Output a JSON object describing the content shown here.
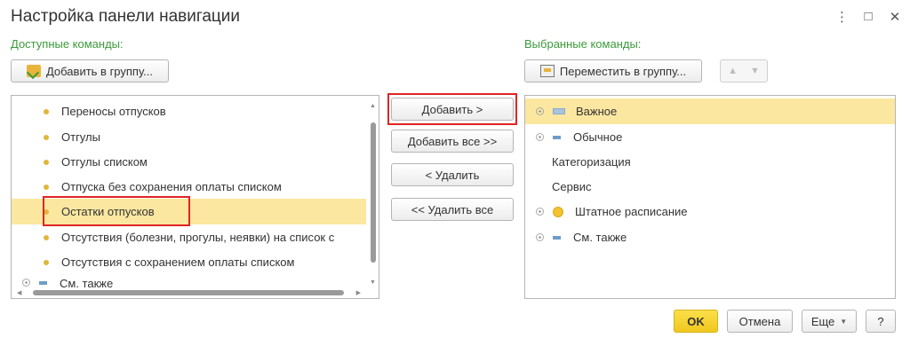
{
  "window": {
    "title": "Настройка панели навигации",
    "controls": [
      "⋮",
      "□",
      "✕"
    ]
  },
  "left": {
    "label": "Доступные команды:",
    "add_group_label": "Добавить в группу...",
    "items": [
      {
        "label": "Переносы отпусков",
        "selected": false
      },
      {
        "label": "Отгулы",
        "selected": false
      },
      {
        "label": "Отгулы списком",
        "selected": false
      },
      {
        "label": "Отпуска без сохранения оплаты списком",
        "selected": false
      },
      {
        "label": "Остатки отпусков",
        "selected": true
      },
      {
        "label": "Отсутствия (болезни, прогулы, неявки) на список с",
        "selected": false
      },
      {
        "label": "Отсутствия с сохранением оплаты списком",
        "selected": false
      }
    ],
    "partial_item": "См. также"
  },
  "middle": {
    "add": "Добавить >",
    "add_all": "Добавить все >>",
    "remove": "< Удалить",
    "remove_all": "<< Удалить все"
  },
  "right": {
    "label": "Выбранные команды:",
    "move_group_label": "Переместить в группу...",
    "items": [
      {
        "label": "Важное",
        "icon": "group-rect-icon",
        "expandable": true,
        "selected": true
      },
      {
        "label": "Обычное",
        "icon": "group-dash-icon",
        "expandable": true,
        "selected": false
      },
      {
        "label": "Категоризация",
        "icon": "",
        "expandable": false,
        "selected": false
      },
      {
        "label": "Сервис",
        "icon": "",
        "expandable": false,
        "selected": false
      },
      {
        "label": "Штатное расписание",
        "icon": "group-circle-icon",
        "expandable": true,
        "selected": false
      },
      {
        "label": "См. также",
        "icon": "group-dash-icon",
        "expandable": true,
        "selected": false
      }
    ]
  },
  "footer": {
    "ok": "OK",
    "cancel": "Отмена",
    "more": "Еще",
    "help": "?"
  },
  "colors": {
    "accent_ok": "#f5d328",
    "selection": "#fbe7a0",
    "section_label": "#3b9b3b",
    "highlight_box": "#e02424"
  }
}
